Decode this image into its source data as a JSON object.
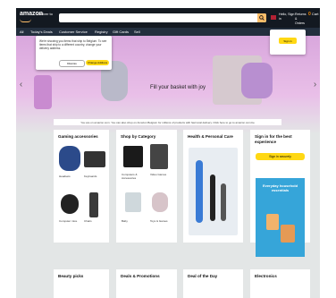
{
  "header": {
    "logo": "amazon",
    "deliver_to": "Deliver to",
    "account": "Hello, Sign in",
    "returns": "Returns & Orders",
    "cart_count": "0",
    "cart_label": "Cart"
  },
  "nav": {
    "items": [
      "All",
      "Today's Deals",
      "Customer Service",
      "Registry",
      "Gift Cards",
      "Sell"
    ]
  },
  "hero": {
    "title": "Fill your basket with joy"
  },
  "popover": {
    "text": "We're showing you items that ship to Belgium. To see items that ship to a different country, change your delivery address.",
    "dismiss_label": "Dismiss",
    "change_label": "Change Address"
  },
  "signin_popover": {
    "button": "Sign in"
  },
  "notice": {
    "text": "You are on amazon.com. You can also shop on Amazon Belgium for millions of products with fast local delivery. Click here to go to amazon.com.be"
  },
  "cards": [
    {
      "title": "Gaming accessories",
      "captions": [
        "Headsets",
        "Keyboards",
        "Computer mice",
        "Chairs"
      ]
    },
    {
      "title": "Shop by Category",
      "captions": [
        "Computers & Accessories",
        "Video Games",
        "Baby",
        "Toys & Games"
      ]
    },
    {
      "title": "Health & Personal Care"
    },
    {
      "title": "Sign in for the best experience",
      "button": "Sign in securely"
    }
  ],
  "bottom_cards": [
    {
      "title": "Beauty picks"
    },
    {
      "title": "Deals & Promotions"
    },
    {
      "title": "Deal of the Day"
    },
    {
      "title": "Electronics"
    }
  ],
  "ad": {
    "title": "Everyday household essentials"
  },
  "colors": {
    "header_bg": "#131921",
    "nav_bg": "#232f3e",
    "accent": "#febd69",
    "button_yellow": "#ffd814",
    "hero_pink": "#e9bfe8"
  }
}
